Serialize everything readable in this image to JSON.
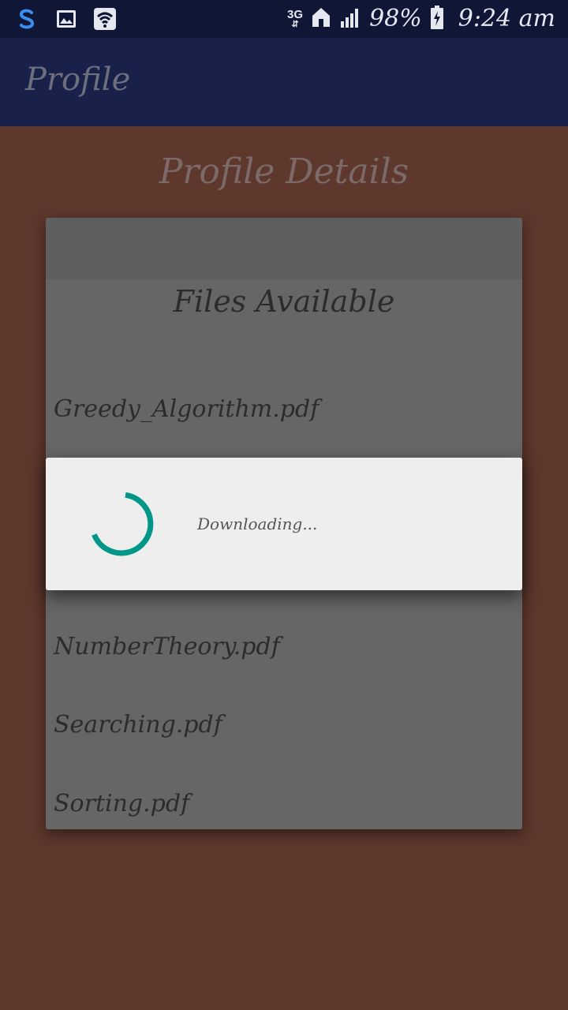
{
  "status_bar": {
    "icons": [
      "s-app-icon",
      "image-icon",
      "wifi-icon",
      "3g-icon",
      "home-icon",
      "signal-icon",
      "battery-charging-icon"
    ],
    "network": "3G",
    "battery": "98%",
    "time": "9:24 am"
  },
  "app_bar": {
    "title": "Profile"
  },
  "main": {
    "section_title": "Profile Details",
    "card": {
      "title": "Files Available",
      "files": [
        "Greedy_Algorithm.pdf",
        "NumberTheory.pdf",
        "Searching.pdf",
        "Sorting.pdf"
      ]
    }
  },
  "dialog": {
    "message": "Downloading...",
    "spinner_color": "#009688"
  },
  "colors": {
    "status_bar": "#0f1636",
    "app_bar": "#19204a",
    "background": "#5e372d",
    "card": "#666666",
    "dialog": "#eeeeee"
  }
}
